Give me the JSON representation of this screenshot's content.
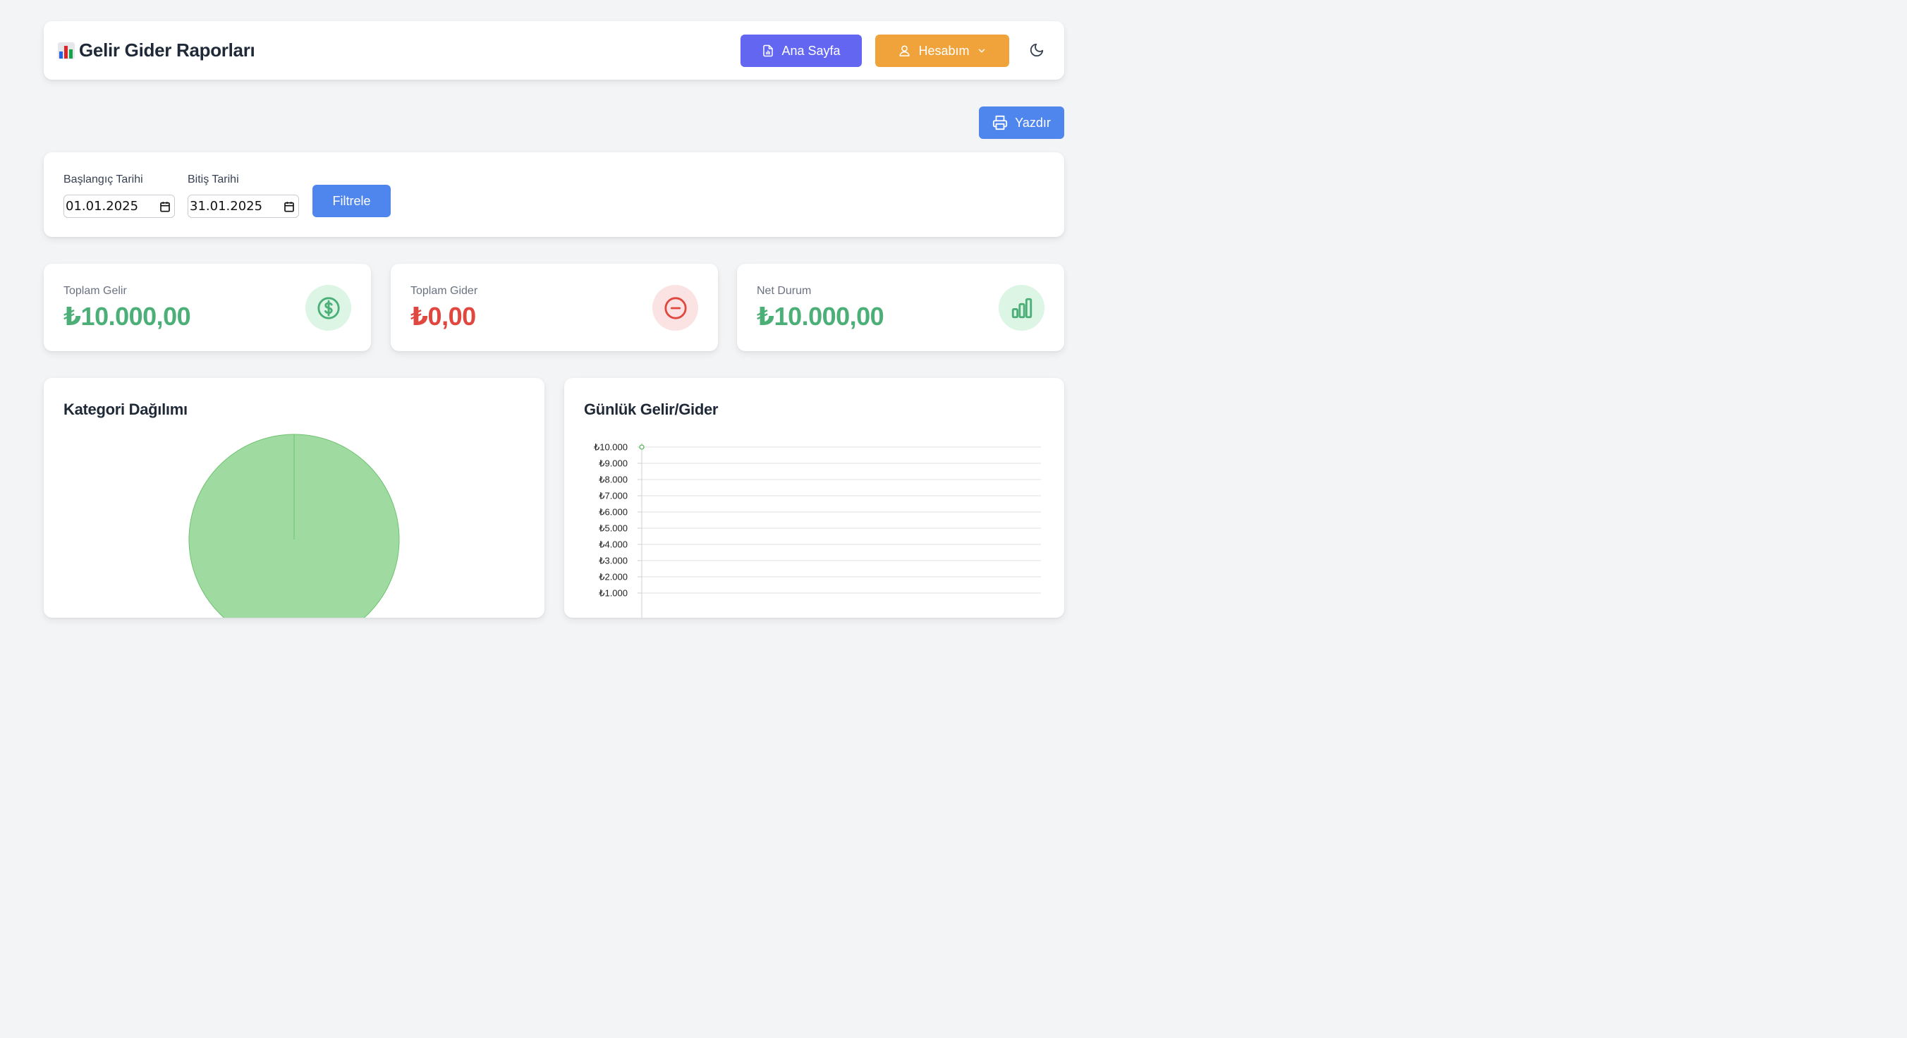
{
  "header": {
    "title": "Gelir Gider Raporları",
    "home_label": "Ana Sayfa",
    "account_label": "Hesabım"
  },
  "toolbar": {
    "print_label": "Yazdır"
  },
  "filter": {
    "start_label": "Başlangıç Tarihi",
    "start_value": "01.01.2025",
    "end_label": "Bitiş Tarihi",
    "end_value": "31.01.2025",
    "filter_label": "Filtrele"
  },
  "stats": [
    {
      "label": "Toplam Gelir",
      "value": "₺10.000,00",
      "color": "#4caf78",
      "icon": "dollar-circle-icon"
    },
    {
      "label": "Toplam Gider",
      "value": "₺0,00",
      "color": "#e0473e",
      "icon": "minus-circle-icon"
    },
    {
      "label": "Net Durum",
      "value": "₺10.000,00",
      "color": "#4caf78",
      "icon": "bar-chart-icon"
    }
  ],
  "colors": {
    "primary": "#4f86ee",
    "indigo": "#6366f1",
    "orange": "#f0a23b",
    "income": "#4caf78",
    "expense": "#e0473e"
  },
  "charts": {
    "pie_title": "Kategori Dağılımı",
    "line_title": "Günlük Gelir/Gider"
  },
  "chart_data": [
    {
      "type": "pie",
      "title": "Kategori Dağılımı",
      "slices": [
        {
          "value": 10000,
          "color": "#9fdba1"
        }
      ]
    },
    {
      "type": "line",
      "title": "Günlük Gelir/Gider",
      "y_ticks": [
        "₺10.000",
        "₺9.000",
        "₺8.000",
        "₺7.000",
        "₺6.000",
        "₺5.000",
        "₺4.000",
        "₺3.000",
        "₺2.000",
        "₺1.000"
      ],
      "ylim": [
        0,
        10000
      ],
      "grid": true,
      "series": [
        {
          "values": [
            10000
          ],
          "color": "#4caf50"
        }
      ]
    }
  ]
}
